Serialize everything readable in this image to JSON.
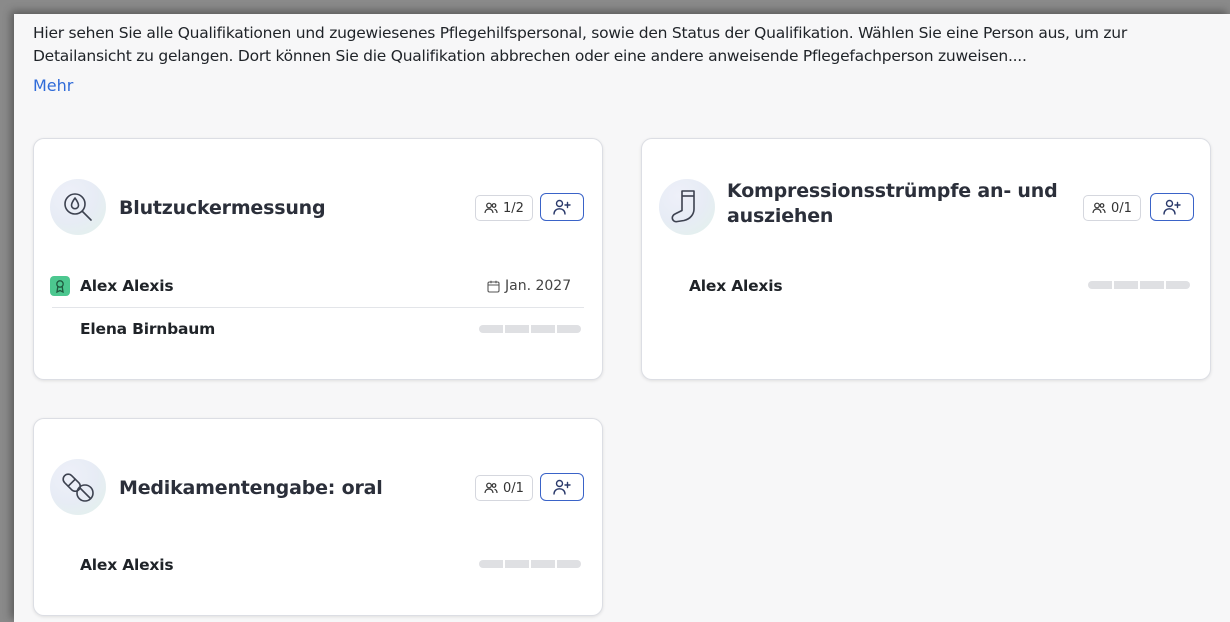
{
  "intro": {
    "text": "Hier sehen Sie alle Qualifikationen und zugewiesenes Pflegehilfspersonal, sowie den Status der Qualifikation. Wählen Sie eine Person aus, um zur Detailansicht zu gelangen. Dort können Sie die Qualifikation abbrechen oder eine andere anweisende Pflegefachperson zuweisen....",
    "more_label": "Mehr"
  },
  "cards": [
    {
      "title": "Blutzuckermessung",
      "icon": "blood-drop-magnifier-icon",
      "count": "1/2",
      "persons": [
        {
          "name": "Alex Alexis",
          "certified": true,
          "date": "Jan. 2027",
          "progress": 1.0
        },
        {
          "name": "Elena Birnbaum",
          "certified": false,
          "progress": 0.0
        }
      ]
    },
    {
      "title_line1": "Kompressionsstrümpfe an- und",
      "title_line2": "ausziehen",
      "icon": "sock-icon",
      "count": "0/1",
      "persons": [
        {
          "name": "Alex Alexis",
          "certified": false,
          "progress": 0.0
        }
      ]
    },
    {
      "title": "Medikamentengabe: oral",
      "icon": "pill-icon",
      "count": "0/1",
      "persons": [
        {
          "name": "Alex Alexis",
          "certified": false,
          "progress": 0.0
        }
      ]
    }
  ],
  "colors": {
    "accent": "#3a63c8",
    "link": "#2f6bd9",
    "certified": "#4cc78f",
    "progress_empty": "#dfe0e3"
  }
}
